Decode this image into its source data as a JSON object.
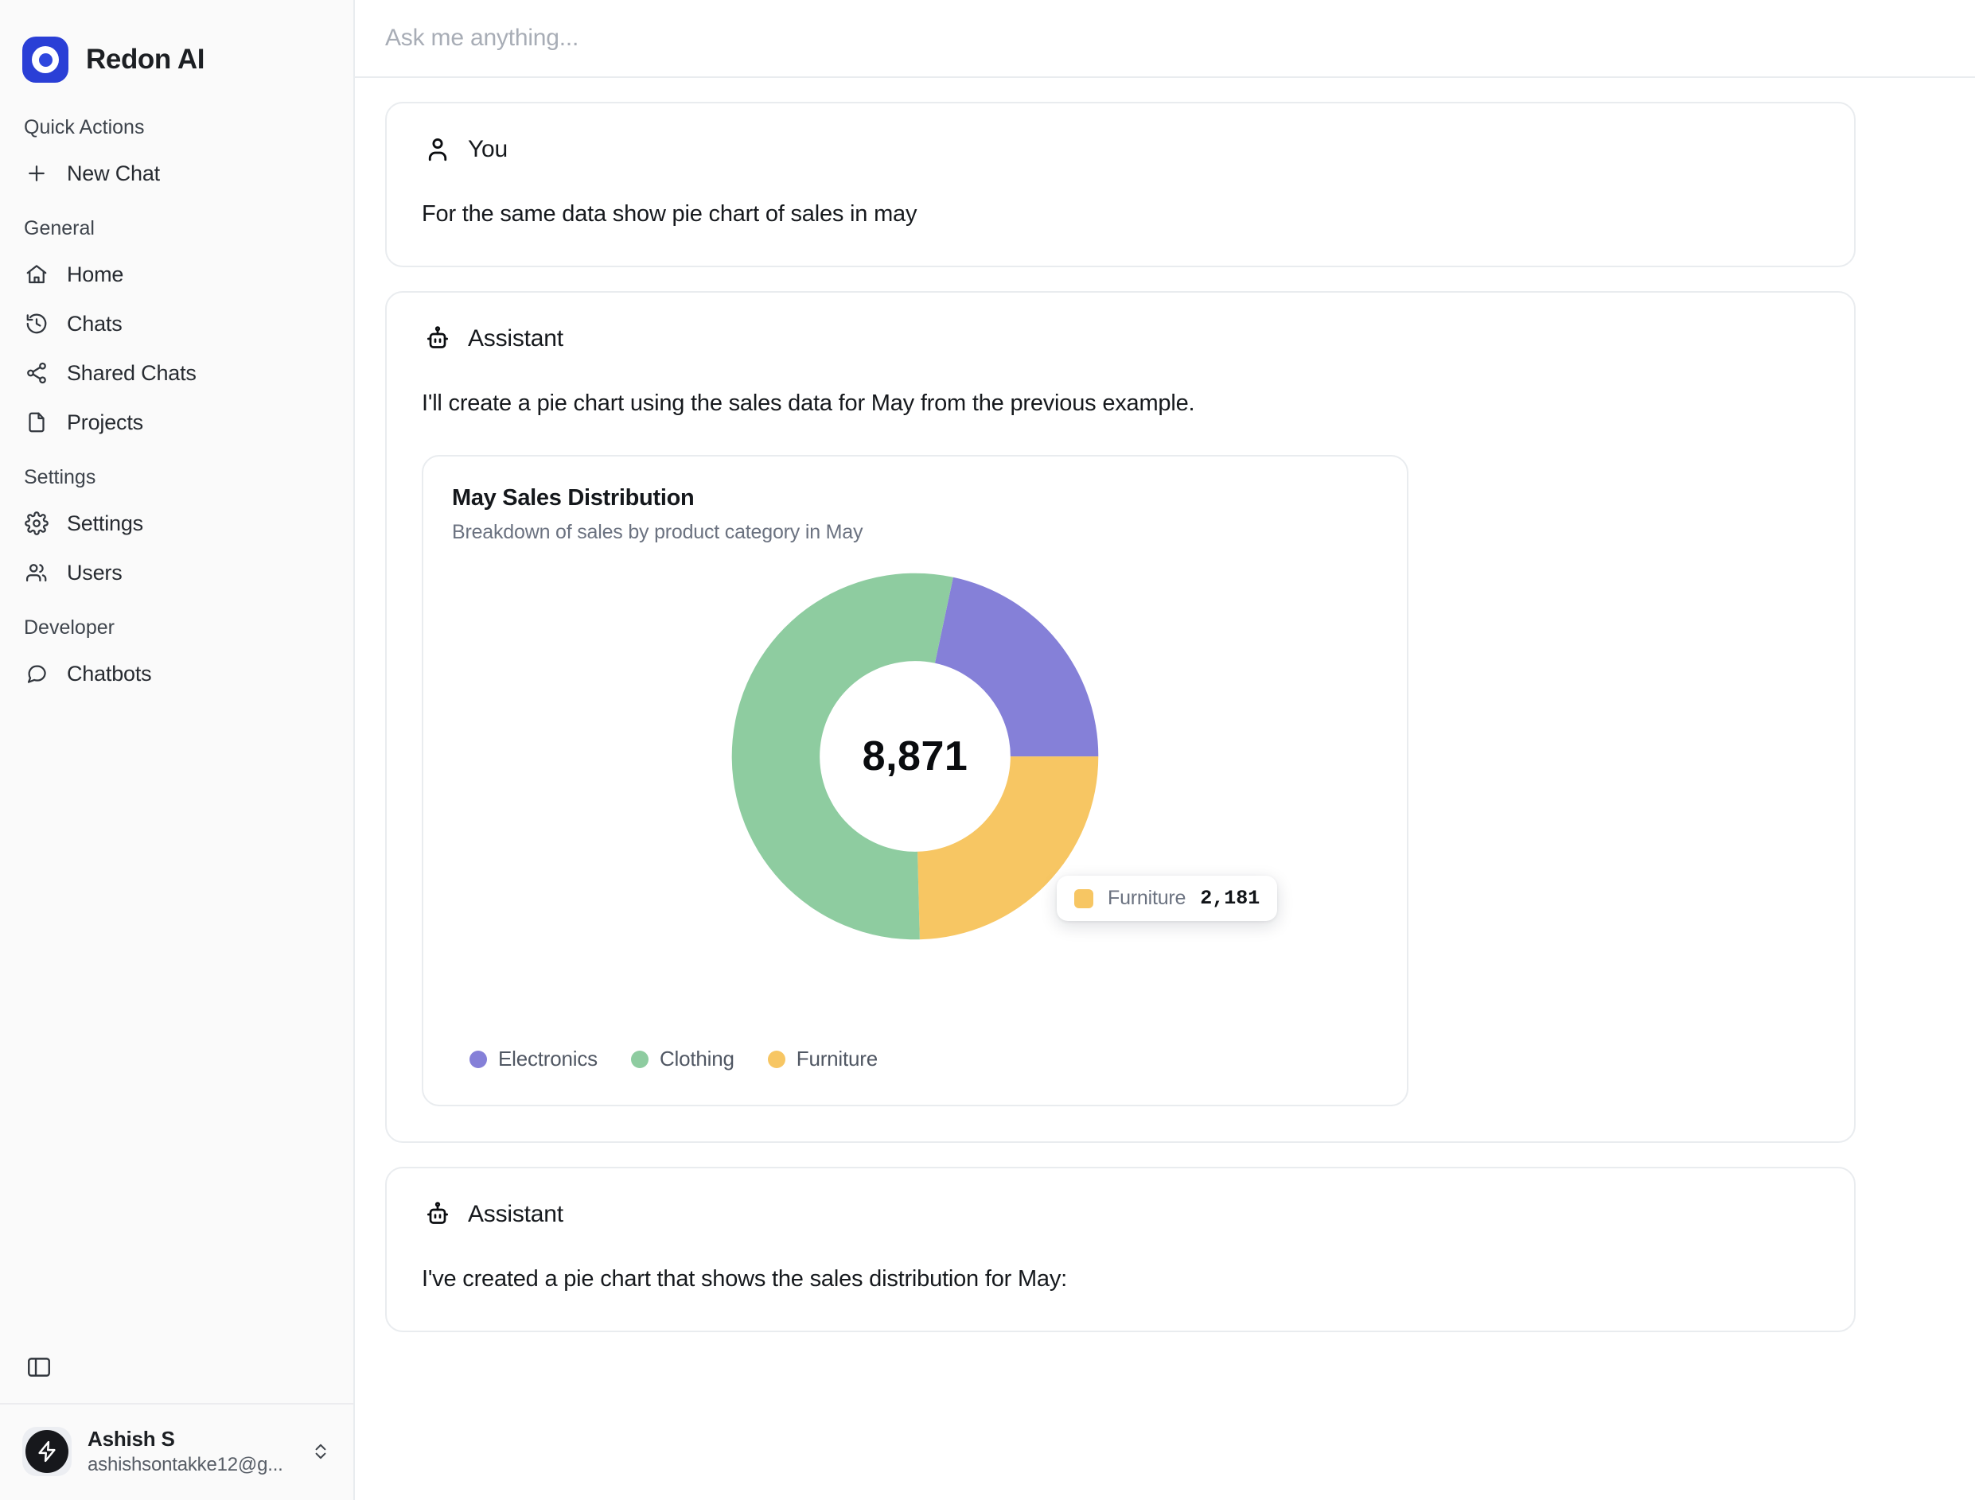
{
  "brand": {
    "name": "Redon AI"
  },
  "sidebar": {
    "sections": [
      {
        "heading": "Quick Actions",
        "items": [
          {
            "label": "New Chat",
            "icon": "plus-icon"
          }
        ]
      },
      {
        "heading": "General",
        "items": [
          {
            "label": "Home",
            "icon": "home-icon"
          },
          {
            "label": "Chats",
            "icon": "history-icon"
          },
          {
            "label": "Shared Chats",
            "icon": "share-icon"
          },
          {
            "label": "Projects",
            "icon": "file-icon"
          }
        ]
      },
      {
        "heading": "Settings",
        "items": [
          {
            "label": "Settings",
            "icon": "gear-icon"
          },
          {
            "label": "Users",
            "icon": "users-icon"
          }
        ]
      },
      {
        "heading": "Developer",
        "items": [
          {
            "label": "Chatbots",
            "icon": "chat-bubble-icon"
          }
        ]
      }
    ],
    "panel_toggle": "sidebar-toggle-icon",
    "user": {
      "name": "Ashish S",
      "email": "ashishsontakke12@g...",
      "avatar_icon": "lightning-bolt-icon",
      "chevrons_icon": "chevron-up-down-icon"
    }
  },
  "topbar": {
    "placeholder": "Ask me anything...",
    "value": ""
  },
  "messages": [
    {
      "role": "You",
      "icon": "user-icon",
      "text": "For the same data show pie chart of sales in may"
    },
    {
      "role": "Assistant",
      "icon": "robot-icon",
      "text": "I'll create a pie chart using the sales data for May from the previous example."
    },
    {
      "role": "Assistant",
      "icon": "robot-icon",
      "text": "I've created a pie chart that shows the sales distribution for May:"
    }
  ],
  "chart_data": {
    "type": "pie",
    "variant": "donut",
    "title": "May Sales Distribution",
    "subtitle": "Breakdown of sales by product category in May",
    "categories": [
      "Electronics",
      "Clothing",
      "Furniture"
    ],
    "values": [
      1923,
      4767,
      2181
    ],
    "colors": [
      "#8580d8",
      "#8ecca0",
      "#f7c663"
    ],
    "center_label": "8,871",
    "total": 8871,
    "legend_position": "bottom",
    "grid": false,
    "start_angle_deg": 12,
    "tooltip": {
      "label": "Furniture",
      "value": "2,181",
      "color": "#f7c663"
    }
  }
}
